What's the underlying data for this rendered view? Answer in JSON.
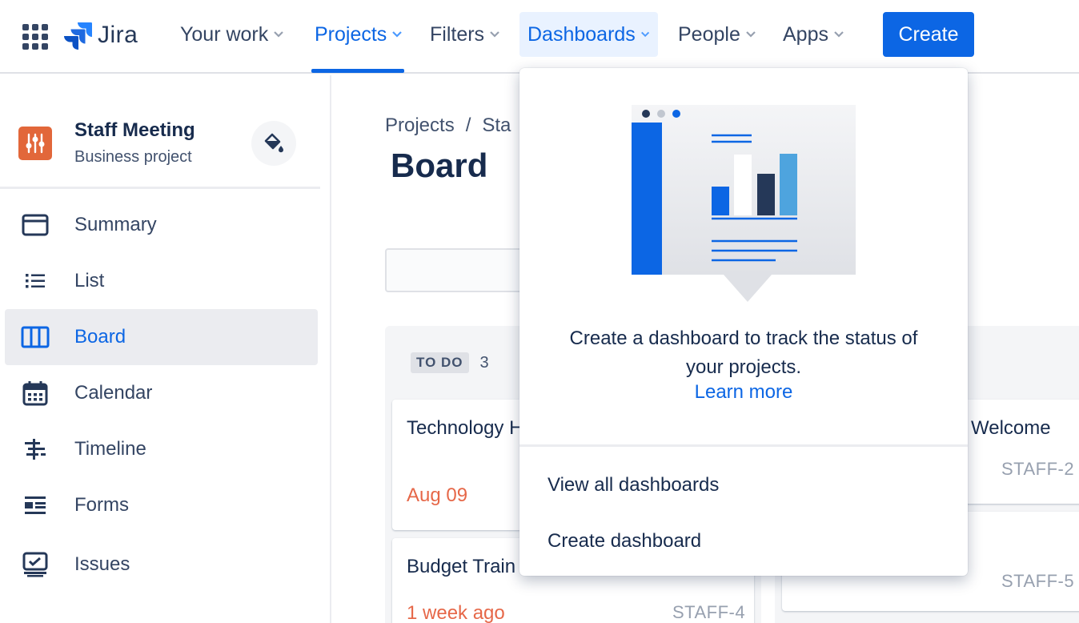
{
  "topnav": {
    "logo_text": "Jira",
    "items": [
      {
        "label": "Your work"
      },
      {
        "label": "Projects"
      },
      {
        "label": "Filters"
      },
      {
        "label": "Dashboards"
      },
      {
        "label": "People"
      },
      {
        "label": "Apps"
      }
    ],
    "create_label": "Create",
    "colors": {
      "accent": "#0c66e4",
      "text": "#344563"
    }
  },
  "sidebar": {
    "project_name": "Staff Meeting",
    "project_type": "Business project",
    "project_avatar_color": "#e2673a",
    "items": [
      {
        "label": "Summary",
        "icon": "summary-icon"
      },
      {
        "label": "List",
        "icon": "list-icon"
      },
      {
        "label": "Board",
        "icon": "board-icon",
        "selected": true
      },
      {
        "label": "Calendar",
        "icon": "calendar-icon"
      },
      {
        "label": "Timeline",
        "icon": "timeline-icon"
      },
      {
        "label": "Forms",
        "icon": "forms-icon"
      },
      {
        "label": "Issues",
        "icon": "issues-icon"
      }
    ]
  },
  "main": {
    "breadcrumb": {
      "root": "Projects",
      "separator": "/",
      "current": "Sta"
    },
    "title": "Board",
    "columns": [
      {
        "badge": "TO DO",
        "count": "3",
        "cards": [
          {
            "title": "Technology Home",
            "due": "Aug 09",
            "key": ""
          },
          {
            "title": "Budget Train",
            "due": "1 week ago",
            "key": "STAFF-4"
          }
        ]
      },
      {
        "cards": [
          {
            "title": "Welcome",
            "key": "STAFF-2"
          },
          {
            "title": "",
            "key": "STAFF-5"
          }
        ]
      }
    ]
  },
  "dashboards_dropdown": {
    "description": "Create a dashboard to track the status of your projects.",
    "learn_more": "Learn more",
    "items": [
      {
        "label": "View all dashboards"
      },
      {
        "label": "Create dashboard"
      }
    ]
  }
}
